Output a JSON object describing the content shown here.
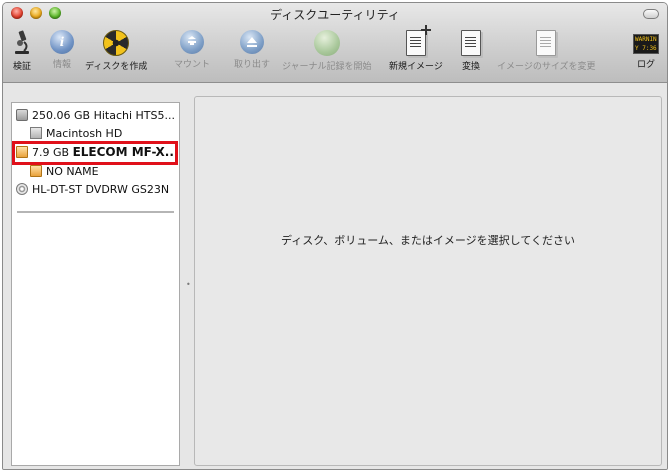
{
  "window": {
    "title": "ディスクユーティリティ"
  },
  "toolbar": [
    {
      "label": "検証",
      "icon": "microscope-icon",
      "enabled": true
    },
    {
      "label": "情報",
      "icon": "info-icon",
      "enabled": false
    },
    {
      "label": "ディスクを作成",
      "icon": "burn-icon",
      "enabled": true
    },
    {
      "label": "マウント",
      "icon": "mount-icon",
      "enabled": false
    },
    {
      "label": "取り出す",
      "icon": "eject-icon",
      "enabled": false
    },
    {
      "label": "ジャーナル記録を開始",
      "icon": "journal-icon",
      "enabled": false
    },
    {
      "label": "新規イメージ",
      "icon": "new-image-icon",
      "enabled": true
    },
    {
      "label": "変換",
      "icon": "convert-icon",
      "enabled": true
    },
    {
      "label": "イメージのサイズを変更",
      "icon": "resize-image-icon",
      "enabled": false
    },
    {
      "label": "ログ",
      "icon": "log-icon",
      "enabled": true,
      "badge": "WARNIN\nY 7:36"
    }
  ],
  "sidebar": {
    "items": [
      {
        "size": "250.06 GB",
        "name": "Hitachi HTS5...",
        "type": "disk",
        "icon": "hard-drive-icon"
      },
      {
        "name": "Macintosh HD",
        "type": "volume",
        "icon": "volume-icon"
      },
      {
        "size": "7.9 GB",
        "name": "ELECOM MF-X...",
        "type": "disk",
        "icon": "usb-drive-icon",
        "highlighted": true
      },
      {
        "name": "NO NAME",
        "type": "volume",
        "icon": "usb-volume-icon"
      },
      {
        "name": "HL-DT-ST DVDRW GS23N",
        "type": "optical",
        "icon": "optical-drive-icon"
      }
    ]
  },
  "main": {
    "placeholder": "ディスク、ボリューム、またはイメージを選択してください"
  },
  "colors": {
    "highlight_border": "#e0101a"
  }
}
